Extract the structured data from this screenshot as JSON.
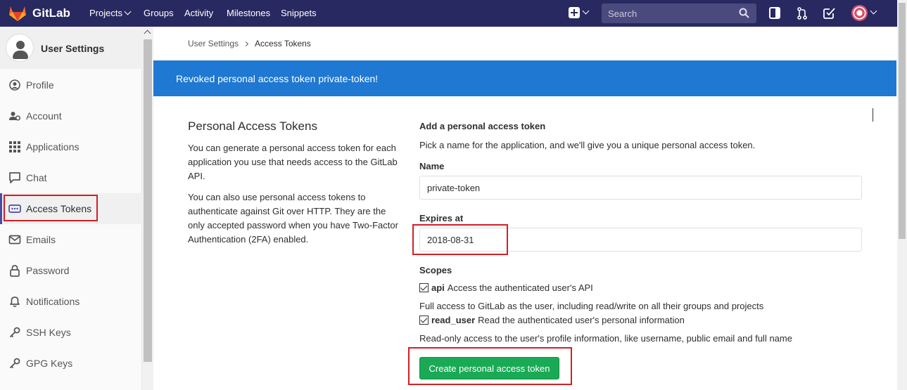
{
  "app": {
    "name": "GitLab"
  },
  "navbar": {
    "links": [
      {
        "label": "Projects",
        "has_caret": true
      },
      {
        "label": "Groups"
      },
      {
        "label": "Activity"
      },
      {
        "label": "Milestones"
      },
      {
        "label": "Snippets"
      }
    ],
    "search_placeholder": "Search",
    "icons": [
      "plus-square-icon",
      "sidebar-toggle-icon",
      "merge-request-icon",
      "todo-check-icon",
      "user-avatar-icon"
    ],
    "bg_color": "#292961"
  },
  "sidebar": {
    "title": "User Settings",
    "items": [
      {
        "label": "Profile",
        "icon": "profile-icon"
      },
      {
        "label": "Account",
        "icon": "account-icon"
      },
      {
        "label": "Applications",
        "icon": "applications-icon"
      },
      {
        "label": "Chat",
        "icon": "chat-icon"
      },
      {
        "label": "Access Tokens",
        "icon": "access-tokens-icon",
        "active": true
      },
      {
        "label": "Emails",
        "icon": "email-icon"
      },
      {
        "label": "Password",
        "icon": "lock-icon"
      },
      {
        "label": "Notifications",
        "icon": "bell-icon"
      },
      {
        "label": "SSH Keys",
        "icon": "key-icon"
      },
      {
        "label": "GPG Keys",
        "icon": "key-icon"
      }
    ]
  },
  "breadcrumb": {
    "parent": "User Settings",
    "current": "Access Tokens"
  },
  "flash": {
    "message": "Revoked personal access token private-token!",
    "color": "#1f78d1"
  },
  "intro": {
    "title": "Personal Access Tokens",
    "para1": "You can generate a personal access token for each application you use that needs access to the GitLab API.",
    "para2": "You can also use personal access tokens to authenticate against Git over HTTP. They are the only accepted password when you have Two-Factor Authentication (2FA) enabled."
  },
  "form": {
    "title": "Add a personal access token",
    "description": "Pick a name for the application, and we'll give you a unique personal access token.",
    "name_label": "Name",
    "name_value": "private-token",
    "expires_label": "Expires at",
    "expires_value": "2018-08-31",
    "scopes_label": "Scopes",
    "scopes": [
      {
        "name": "api",
        "desc": "Access the authenticated user's API",
        "help": "Full access to GitLab as the user, including read/write on all their groups and projects",
        "checked": true
      },
      {
        "name": "read_user",
        "desc": "Read the authenticated user's personal information",
        "help": "Read-only access to the user's profile information, like username, public email and full name",
        "checked": true
      }
    ],
    "submit_label": "Create personal access token",
    "submit_color": "#1aaa55"
  },
  "highlight_color": "#d21f26"
}
